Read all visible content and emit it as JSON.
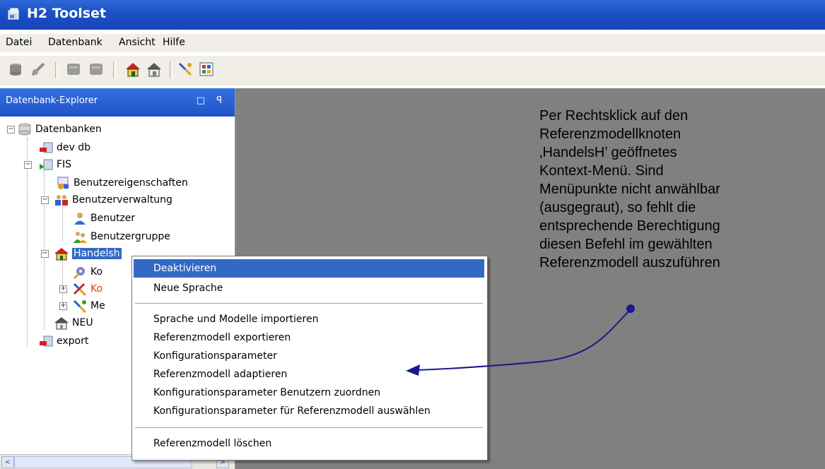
{
  "window": {
    "title": "H2 Toolset"
  },
  "menubar": {
    "items": [
      "Datei",
      "Datenbank",
      "Ansicht",
      "Hilfe"
    ]
  },
  "toolbar": {
    "icons": [
      "connect-icon",
      "disconnect-icon",
      "db-icon",
      "db-gray-icon",
      "home-icon",
      "home-gray-icon",
      "tool-icon",
      "grid-icon"
    ]
  },
  "explorer": {
    "title": "Datenbank-Explorer",
    "buttons": "□ ꟼ",
    "tree": {
      "root": "Datenbanken",
      "dev_db": "dev db",
      "fis": "FIS",
      "benutzereigenschaften": "Benutzereigenschaften",
      "benutzerverwaltung": "Benutzerverwaltung",
      "benutzer": "Benutzer",
      "benutzergruppe": "Benutzergruppe",
      "handelsh": "Handelsh",
      "ko1": "Ko",
      "ko2": "Ko",
      "me": "Me",
      "neu": "NEU",
      "export": "export"
    },
    "scroll_left": "<",
    "scroll_right": ">"
  },
  "context_menu": {
    "items": [
      "Deaktivieren",
      "Neue Sprache",
      "Sprache und Modelle importieren",
      "Referenzmodell exportieren",
      "Konfigurationsparameter",
      "Referenzmodell adaptieren",
      "Konfigurationsparameter Benutzern zuordnen",
      "Konfigurationsparameter für Referenzmodell auswählen",
      "Referenzmodell löschen"
    ],
    "highlighted": "Deaktivieren"
  },
  "annotation": {
    "lines": [
      "Per Rechtsklick auf den",
      "Referenzmodellknoten",
      "‚HandelsH’ geöffnetes",
      "Kontext-Menü. Sind",
      "Menüpunkte nicht anwählbar",
      "(ausgegraut), so fehlt die",
      "entsprechende Berechtigung",
      "diesen Befehl im gewählten",
      "Referenzmodell auszuführen"
    ]
  },
  "colors": {
    "titlebar": "#1a4fc6",
    "selection": "#316ac5",
    "workspace": "#808080",
    "arrow": "#1a1a8c"
  }
}
